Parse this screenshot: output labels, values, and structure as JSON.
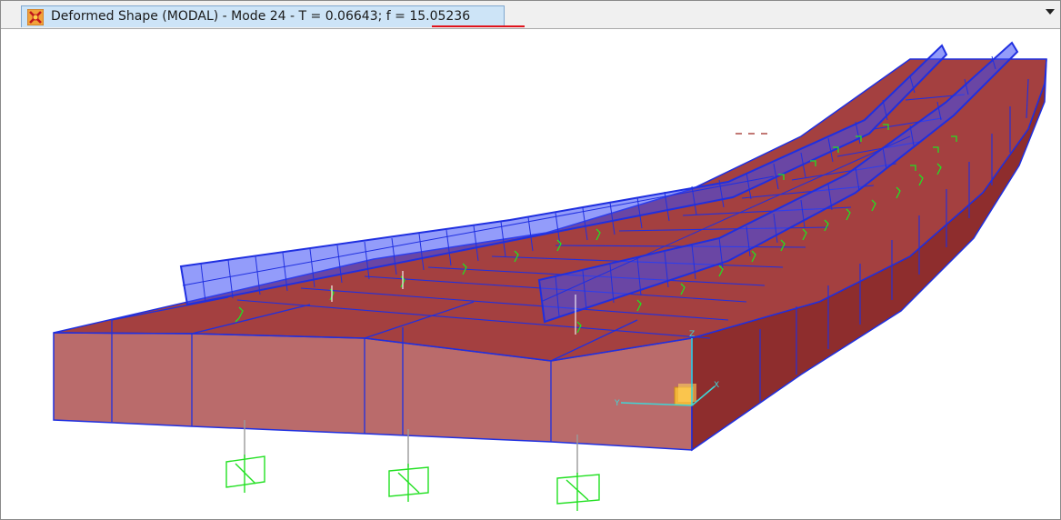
{
  "window": {
    "tab_title": "Deformed Shape (MODAL) - Mode 24 - T = 0.06643;  f = 15.05236",
    "tab_icon": "modal-shape-icon"
  },
  "viewport": {
    "content": "3d-bridge-model",
    "deck_fill": "#8b0000",
    "frame_color": "#1f2fe0",
    "support_color": "#22e022",
    "axes": {
      "x_label": "X",
      "y_label": "Y",
      "z_label": "Z"
    }
  },
  "colors": {
    "tab_bg": "#cde4f7",
    "underline": "#e0121b"
  }
}
